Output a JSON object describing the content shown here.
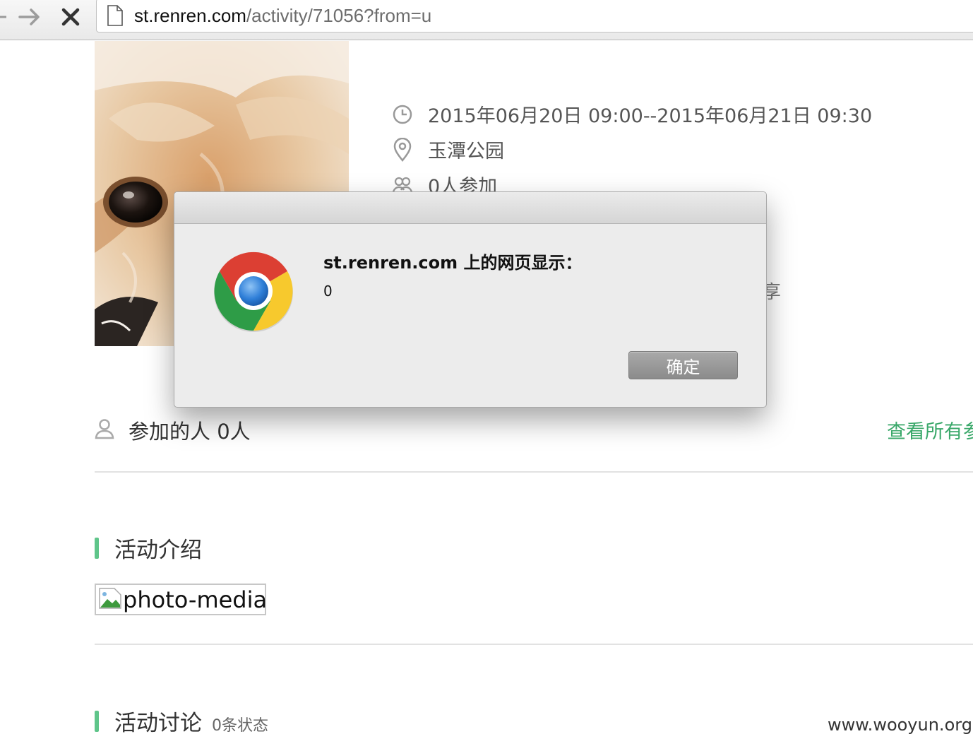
{
  "browser": {
    "url_host": "st.renren.com",
    "url_path": "/activity/71056?from=u",
    "icons": [
      "back-arrow-icon",
      "forward-arrow-icon",
      "stop-icon",
      "page-icon"
    ]
  },
  "activity": {
    "time": "2015年06月20日 09:00--2015年06月21日 09:30",
    "location": "玉潭公园",
    "participants_summary": "0人参加",
    "partial_text_right": "享"
  },
  "participants": {
    "label": "参加的人 0人",
    "view_all": "查看所有参"
  },
  "sections": {
    "intro_title": "活动介绍",
    "photo_alt": "photo-media",
    "discussion_title": "活动讨论",
    "discussion_count": "0条状态"
  },
  "dialog": {
    "title": "st.renren.com 上的网页显示：",
    "message": "0",
    "ok_label": "确定"
  },
  "watermark": "www.wooyun.org",
  "colors": {
    "accent_green": "#3aa86a",
    "section_bar": "#5fc58a",
    "dialog_bg": "#ececec",
    "button_gray": "#8b8b8b"
  }
}
